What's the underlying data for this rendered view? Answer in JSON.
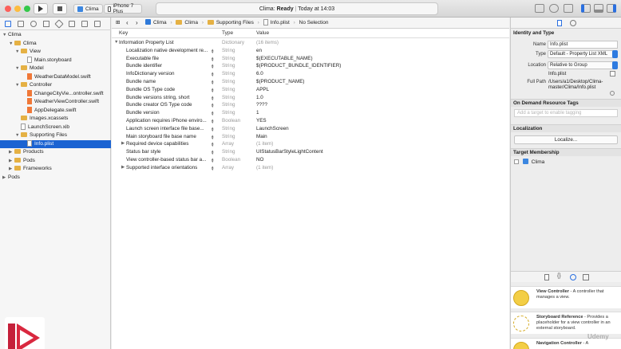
{
  "toolbar": {
    "scheme": "Clima",
    "device": "iPhone 7 Plus",
    "status_app": "Clima:",
    "status_state": "Ready",
    "status_sep": "|",
    "status_time": "Today at 14:03"
  },
  "navigator": {
    "items": [
      {
        "label": "Clima",
        "indent": 0,
        "kind": "project",
        "disc": "▼"
      },
      {
        "label": "Clima",
        "indent": 1,
        "kind": "folder",
        "disc": "▼"
      },
      {
        "label": "View",
        "indent": 2,
        "kind": "folder",
        "disc": "▼"
      },
      {
        "label": "Main.storyboard",
        "indent": 3,
        "kind": "file",
        "disc": ""
      },
      {
        "label": "Model",
        "indent": 2,
        "kind": "folder",
        "disc": "▼"
      },
      {
        "label": "WeatherDataModel.swift",
        "indent": 3,
        "kind": "swift",
        "disc": ""
      },
      {
        "label": "Controller",
        "indent": 2,
        "kind": "folder",
        "disc": "▼"
      },
      {
        "label": "ChangeCityVie...ontroller.swift",
        "indent": 3,
        "kind": "swift",
        "disc": ""
      },
      {
        "label": "WeatherViewController.swift",
        "indent": 3,
        "kind": "swift",
        "disc": ""
      },
      {
        "label": "AppDelegate.swift",
        "indent": 3,
        "kind": "swift",
        "disc": ""
      },
      {
        "label": "Images.xcassets",
        "indent": 2,
        "kind": "folder",
        "disc": ""
      },
      {
        "label": "LaunchScreen.xib",
        "indent": 2,
        "kind": "file",
        "disc": ""
      },
      {
        "label": "Supporting Files",
        "indent": 2,
        "kind": "folder",
        "disc": "▼"
      },
      {
        "label": "Info.plist",
        "indent": 3,
        "kind": "file",
        "disc": "",
        "selected": true
      },
      {
        "label": "Products",
        "indent": 1,
        "kind": "folder",
        "disc": "▶"
      },
      {
        "label": "Pods",
        "indent": 1,
        "kind": "folder",
        "disc": "▶"
      },
      {
        "label": "Frameworks",
        "indent": 1,
        "kind": "folder",
        "disc": "▶"
      },
      {
        "label": "Pods",
        "indent": 0,
        "kind": "project",
        "disc": "▶"
      }
    ]
  },
  "jumpbar": {
    "crumbs": [
      "Clima",
      "Clima",
      "Supporting Files",
      "Info.plist",
      "No Selection"
    ]
  },
  "plist": {
    "headers": {
      "key": "Key",
      "type": "Type",
      "value": "Value"
    },
    "rows": [
      {
        "key": "Information Property List",
        "type": "Dictionary",
        "value": "(16 items)",
        "level": 0,
        "disc": "▼",
        "gray": true
      },
      {
        "key": "Localization native development re...",
        "type": "String",
        "value": "en",
        "level": 1,
        "disc": ""
      },
      {
        "key": "Executable file",
        "type": "String",
        "value": "$(EXECUTABLE_NAME)",
        "level": 1,
        "disc": ""
      },
      {
        "key": "Bundle identifier",
        "type": "String",
        "value": "$(PRODUCT_BUNDLE_IDENTIFIER)",
        "level": 1,
        "disc": ""
      },
      {
        "key": "InfoDictionary version",
        "type": "String",
        "value": "6.0",
        "level": 1,
        "disc": ""
      },
      {
        "key": "Bundle name",
        "type": "String",
        "value": "$(PRODUCT_NAME)",
        "level": 1,
        "disc": ""
      },
      {
        "key": "Bundle OS Type code",
        "type": "String",
        "value": "APPL",
        "level": 1,
        "disc": ""
      },
      {
        "key": "Bundle versions string, short",
        "type": "String",
        "value": "1.0",
        "level": 1,
        "disc": ""
      },
      {
        "key": "Bundle creator OS Type code",
        "type": "String",
        "value": "????",
        "level": 1,
        "disc": ""
      },
      {
        "key": "Bundle version",
        "type": "String",
        "value": "1",
        "level": 1,
        "disc": ""
      },
      {
        "key": "Application requires iPhone enviro...",
        "type": "Boolean",
        "value": "YES",
        "level": 1,
        "disc": ""
      },
      {
        "key": "Launch screen interface file base...",
        "type": "String",
        "value": "LaunchScreen",
        "level": 1,
        "disc": ""
      },
      {
        "key": "Main storyboard file base name",
        "type": "String",
        "value": "Main",
        "level": 1,
        "disc": ""
      },
      {
        "key": "Required device capabilities",
        "type": "Array",
        "value": "(1 item)",
        "level": 1,
        "disc": "▶",
        "gray": true
      },
      {
        "key": "Status bar style",
        "type": "String",
        "value": "UIStatusBarStyleLightContent",
        "level": 1,
        "disc": ""
      },
      {
        "key": "View controller-based status bar a...",
        "type": "Boolean",
        "value": "NO",
        "level": 1,
        "disc": ""
      },
      {
        "key": "Supported interface orientations",
        "type": "Array",
        "value": "(1 item)",
        "level": 1,
        "disc": "▶",
        "gray": true
      }
    ]
  },
  "inspector": {
    "identity_title": "Identity and Type",
    "name_label": "Name",
    "name_value": "Info.plist",
    "type_label": "Type",
    "type_value": "Default - Property List XML",
    "location_label": "Location",
    "location_value": "Relative to Group",
    "location_file": "Info.plist",
    "fullpath_label": "Full Path",
    "fullpath_value": "/Users/a1/Desktop/Clima-master/Clima/Info.plist",
    "odr_title": "On Demand Resource Tags",
    "odr_placeholder": "Add a target to enable tagging",
    "loc_title": "Localization",
    "localize_button": "Localize...",
    "target_title": "Target Membership",
    "target_name": "Clima"
  },
  "library": {
    "items": [
      {
        "title": "View Controller",
        "desc": " - A controller that manages a view."
      },
      {
        "title": "Storyboard Reference",
        "desc": " - Provides a placeholder for a view controller in an external storyboard."
      },
      {
        "title": "Navigation Controller",
        "desc": " - A"
      }
    ]
  },
  "watermark": "Udemy"
}
